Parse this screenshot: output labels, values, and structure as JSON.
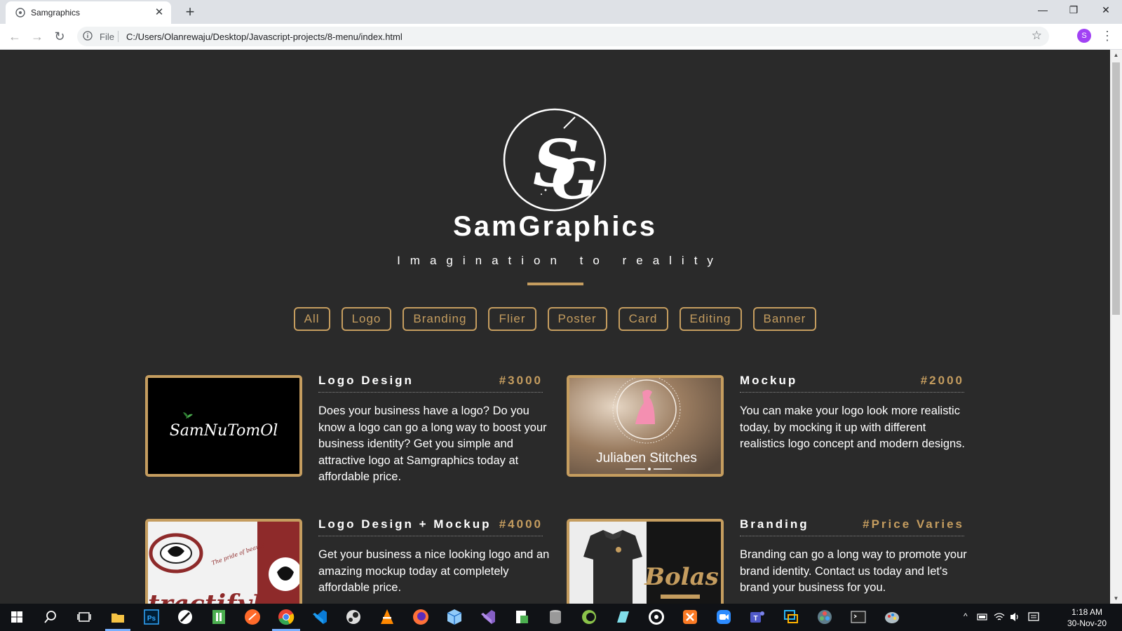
{
  "browser": {
    "tab_title": "Samgraphics",
    "close_glyph": "✕",
    "newtab_glyph": "+",
    "window_controls": {
      "minimize": "—",
      "restore": "❐",
      "close": "✕"
    },
    "nav": {
      "back": "←",
      "forward": "→",
      "reload": "↻"
    },
    "scheme": "File",
    "url": "C:/Users/Olanrewaju/Desktop/Javascript-projects/8-menu/index.html",
    "star": "☆",
    "profile_initial": "S",
    "menu": "⋮"
  },
  "page": {
    "brand": "SamGraphics",
    "tagline": "Imagination to reality",
    "logo_initials": "SG",
    "filters": [
      "All",
      "Logo",
      "Branding",
      "Flier",
      "Poster",
      "Card",
      "Editing",
      "Banner"
    ],
    "items": [
      {
        "name": "Logo Design",
        "price": "#3000",
        "desc": "Does your business have a logo? Do you know a logo can go a long way to boost your business identity? Get you simple and attractive logo at Samgraphics today at affordable price.",
        "image_text": "SamNuTomOl"
      },
      {
        "name": "Mockup",
        "price": "#2000",
        "desc": "You can make your logo look more realistic today, by mocking it up with different realistics logo concept and modern designs.",
        "image_text": "Juliaben Stitches"
      },
      {
        "name": "Logo Design + Mockup",
        "price": "#4000",
        "desc": "Get your business a nice looking logo and an amazing mockup today at completely affordable price.",
        "image_text": "tractifyIT",
        "image_subtext": "The pride of beauty"
      },
      {
        "name": "Branding",
        "price": "#Price Varies",
        "desc": "Branding can go a long way to promote your brand identity. Contact us today and let's brand your business for you.",
        "image_text": "Bolas"
      }
    ]
  },
  "taskbar": {
    "icons": [
      "windows-start",
      "search",
      "task-view",
      "file-explorer",
      "photoshop",
      "inkscape",
      "onenote",
      "sublime",
      "chrome",
      "vscode",
      "steam",
      "vlc",
      "firefox",
      "virtualbox",
      "visual-studio",
      "installer",
      "database",
      "coreldraw",
      "notepad",
      "obs",
      "xampp",
      "zoom",
      "teams",
      "remote-desktop",
      "davinci",
      "terminal",
      "paint"
    ],
    "time": "1:18 AM",
    "date": "30-Nov-20"
  },
  "colors": {
    "accent": "#c59d5f",
    "page_bg": "#2a2a2a",
    "text": "#ffffff"
  }
}
